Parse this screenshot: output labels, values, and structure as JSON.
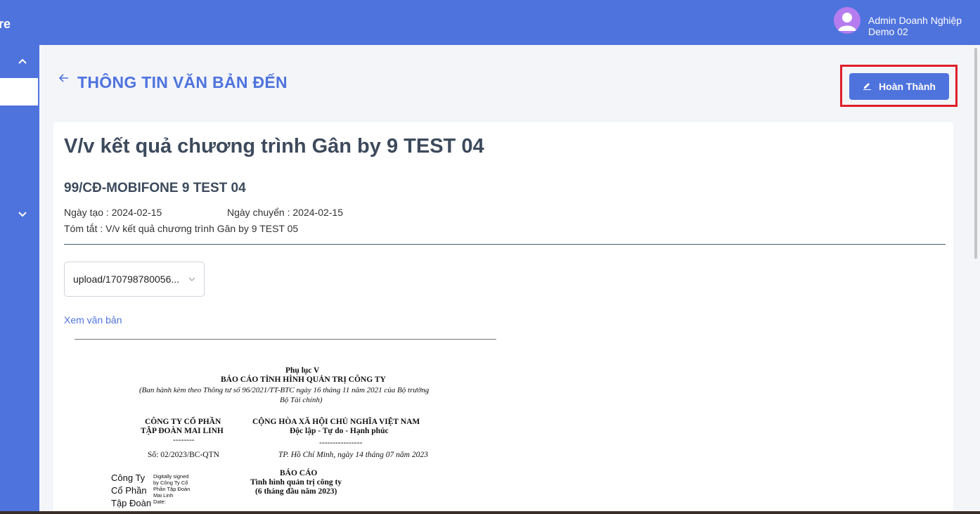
{
  "sidebar": {
    "brand": "re"
  },
  "header": {
    "username": "Admin Doanh Nghiệp Demo 02"
  },
  "page": {
    "title": "THÔNG TIN VĂN BẢN ĐẾN",
    "done_button": "Hoàn Thành"
  },
  "document": {
    "title": "V/v kết quả chương trình Gân by 9 TEST 04",
    "code": "99/CĐ-MOBIFONE 9 TEST 04",
    "created_label": "Ngày tạo : 2024-02-15",
    "transferred_label": "Ngày chuyển : 2024-02-15",
    "summary_label": "Tóm tắt : V/v kết quả chương trình Gân by 9 TEST 05",
    "file_select_value": "upload/170798780056...",
    "view_link": "Xem văn bản"
  },
  "preview": {
    "appendix": "Phụ lục V",
    "report_title": "BÁO CÁO TÌNH HÌNH QUẢN TRỊ CÔNG TY",
    "issued_note_1": "(Ban hành kèm theo Thông tư số 96/2021/TT-BTC ngày 16 tháng 11 năm 2021 của Bộ trưởng",
    "issued_note_2": "Bộ Tài chính)",
    "company_1": "CÔNG TY CỔ PHẦN",
    "company_2": "TẬP ĐOÀN MAI LINH",
    "dash_1": "--------",
    "republic": "CỘNG HÒA XÃ HỘI CHỦ NGHĨA VIỆT NAM",
    "motto": "Độc lập - Tự do - Hạnh phúc",
    "dash_2": "----------------",
    "number": "Số: 02/2023/BC-QTN",
    "place_date": "TP. Hồ Chí Minh, ngày 14 tháng 07 năm 2023",
    "report": "BÁO CÁO",
    "report_sub": "Tình hình quản trị công ty",
    "report_period": "(6 tháng đầu năm 2023)",
    "sig_1": "Công Ty",
    "sig_2": "Cổ Phần",
    "sig_3": "Tập Đoàn",
    "sig_small_1": "Digitally signed",
    "sig_small_2": "by Công Ty Cổ",
    "sig_small_3": "Phần Tập Đoàn",
    "sig_small_4": "Mai Linh",
    "sig_small_5": "Date:"
  },
  "icons": {
    "back": "arrow-left-icon",
    "edit": "pencil-icon",
    "avatar": "user-icon"
  },
  "colors": {
    "primary": "#4f73dd",
    "highlight": "#e0202a",
    "avatar": "#b57cf0"
  }
}
